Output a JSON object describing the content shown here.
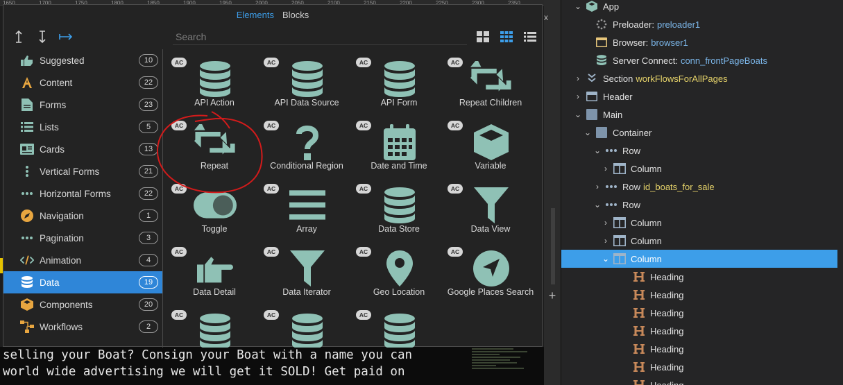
{
  "ruler": {
    "ticks": [
      "1650",
      "1700",
      "1750",
      "1800",
      "1850",
      "1900",
      "1950",
      "2000",
      "2050",
      "2100",
      "2150",
      "2200",
      "2250",
      "2300",
      "2350"
    ]
  },
  "background_text": {
    "lines": [
      "selling your Boat? Consign your Boat with a name you can",
      "world wide advertising we will get it SOLD! Get paid on"
    ]
  },
  "gutter": {
    "close_glyph": "x",
    "add_glyph": "+"
  },
  "picker": {
    "tabs": [
      {
        "label": "Elements",
        "active": true
      },
      {
        "label": "Blocks",
        "active": false
      }
    ],
    "search_placeholder": "Search",
    "categories": [
      {
        "label": "Suggested",
        "count": "10",
        "icon": "thumbs-up-icon"
      },
      {
        "label": "Content",
        "count": "22",
        "icon": "letter-a-icon"
      },
      {
        "label": "Forms",
        "count": "23",
        "icon": "form-icon"
      },
      {
        "label": "Lists",
        "count": "5",
        "icon": "list-icon"
      },
      {
        "label": "Cards",
        "count": "13",
        "icon": "card-icon"
      },
      {
        "label": "Vertical Forms",
        "count": "21",
        "icon": "vertical-dots-icon"
      },
      {
        "label": "Horizontal Forms",
        "count": "22",
        "icon": "horizontal-dots-icon"
      },
      {
        "label": "Navigation",
        "count": "1",
        "icon": "compass-icon"
      },
      {
        "label": "Pagination",
        "count": "3",
        "icon": "ellipsis-icon"
      },
      {
        "label": "Animation",
        "count": "4",
        "icon": "code-icon"
      },
      {
        "label": "Data",
        "count": "19",
        "icon": "database-icon",
        "active": true
      },
      {
        "label": "Components",
        "count": "20",
        "icon": "cube-icon"
      },
      {
        "label": "Workflows",
        "count": "2",
        "icon": "workflow-icon"
      }
    ],
    "elements": [
      {
        "label": "API Action",
        "badge": "AC",
        "icon": "database-icon"
      },
      {
        "label": "API Data Source",
        "badge": "AC",
        "icon": "database-icon"
      },
      {
        "label": "API Form",
        "badge": "AC",
        "icon": "database-icon"
      },
      {
        "label": "Repeat Children",
        "badge": "AC",
        "icon": "repeat-icon"
      },
      {
        "label": "Repeat",
        "badge": "AC",
        "icon": "repeat-icon"
      },
      {
        "label": "Conditional Region",
        "badge": "AC",
        "icon": "question-icon"
      },
      {
        "label": "Date and Time",
        "badge": "AC",
        "icon": "calendar-icon"
      },
      {
        "label": "Variable",
        "badge": "AC",
        "icon": "box-icon"
      },
      {
        "label": "Toggle",
        "badge": "AC",
        "icon": "toggle-icon"
      },
      {
        "label": "Array",
        "badge": "AC",
        "icon": "bars-icon"
      },
      {
        "label": "Data Store",
        "badge": "AC",
        "icon": "database-icon"
      },
      {
        "label": "Data View",
        "badge": "AC",
        "icon": "filter-icon"
      },
      {
        "label": "Data Detail",
        "badge": "AC",
        "icon": "pointing-hand-icon"
      },
      {
        "label": "Data Iterator",
        "badge": "AC",
        "icon": "filter-icon"
      },
      {
        "label": "Geo Location",
        "badge": "AC",
        "icon": "map-marker-icon"
      },
      {
        "label": "Google Places Search",
        "badge": "AC",
        "icon": "location-arrow-icon"
      },
      {
        "label": "",
        "badge": "AC",
        "icon": "database-icon"
      },
      {
        "label": "",
        "badge": "AC",
        "icon": "database-icon"
      },
      {
        "label": "",
        "badge": "AC",
        "icon": "database-icon"
      }
    ],
    "colors": {
      "accent": "#3d9ee9",
      "icon": "#8fc1b5"
    }
  },
  "tree": {
    "nodes": [
      {
        "label": "App",
        "value": "",
        "icon": "cube-icon",
        "chev": "v"
      },
      {
        "label": "Preloader:",
        "value": "preloader1",
        "icon": "spinner-icon",
        "chev": ""
      },
      {
        "label": "Browser:",
        "value": "browser1",
        "icon": "browser-icon",
        "chev": ""
      },
      {
        "label": "Server Connect:",
        "value": "conn_frontPageBoats",
        "icon": "database-icon",
        "chev": ""
      },
      {
        "label": "Section",
        "value": "workFlowsForAllPages",
        "icon": "section-icon",
        "chev": ">"
      },
      {
        "label": "Header",
        "value": "",
        "icon": "header-icon",
        "chev": ">"
      },
      {
        "label": "Main",
        "value": "",
        "icon": "main-icon",
        "chev": "v"
      },
      {
        "label": "Container",
        "value": "",
        "icon": "container-icon",
        "chev": "v"
      },
      {
        "label": "Row",
        "value": "",
        "icon": "row-icon",
        "chev": "v"
      },
      {
        "label": "Column",
        "value": "",
        "icon": "column-icon",
        "chev": ">"
      },
      {
        "label": "Row",
        "value": "id_boats_for_sale",
        "icon": "row-icon",
        "chev": ">"
      },
      {
        "label": "Row",
        "value": "",
        "icon": "row-icon",
        "chev": "v"
      },
      {
        "label": "Column",
        "value": "",
        "icon": "column-icon",
        "chev": ">"
      },
      {
        "label": "Column",
        "value": "",
        "icon": "column-icon",
        "chev": ">"
      },
      {
        "label": "Column",
        "value": "",
        "icon": "column-icon",
        "chev": "v",
        "selected": true
      },
      {
        "label": "Heading",
        "value": "",
        "icon": "heading-icon",
        "chev": ""
      },
      {
        "label": "Heading",
        "value": "",
        "icon": "heading-icon",
        "chev": ""
      },
      {
        "label": "Heading",
        "value": "",
        "icon": "heading-icon",
        "chev": ""
      },
      {
        "label": "Heading",
        "value": "",
        "icon": "heading-icon",
        "chev": ""
      },
      {
        "label": "Heading",
        "value": "",
        "icon": "heading-icon",
        "chev": ""
      },
      {
        "label": "Heading",
        "value": "",
        "icon": "heading-icon",
        "chev": ""
      },
      {
        "label": "Heading",
        "value": "",
        "icon": "heading-icon",
        "chev": ""
      }
    ]
  }
}
